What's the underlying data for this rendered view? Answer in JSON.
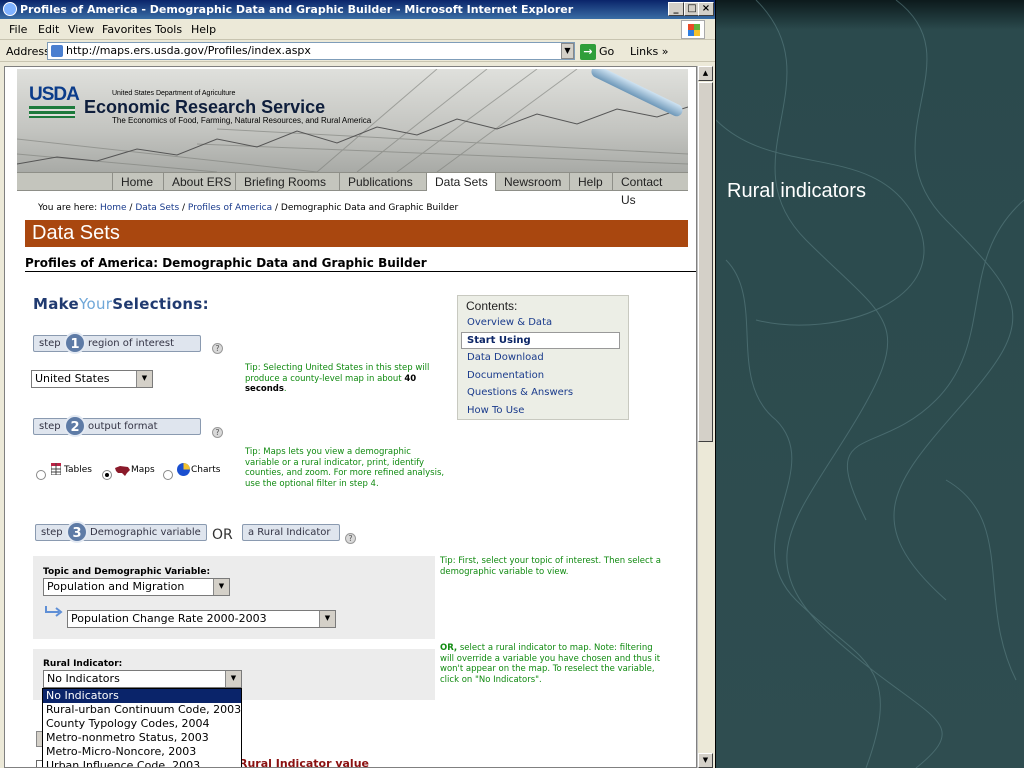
{
  "slide": {
    "caption": "Rural indicators"
  },
  "window": {
    "title": "Profiles of America - Demographic Data and Graphic Builder - Microsoft Internet Explorer",
    "buttons": [
      "_",
      "□",
      "×"
    ]
  },
  "menu": [
    "File",
    "Edit",
    "View",
    "Favorites",
    "Tools",
    "Help"
  ],
  "address_bar": {
    "label": "Address",
    "url": "http://maps.ers.usda.gov/Profiles/index.aspx",
    "go_label": "Go",
    "links_label": "Links »"
  },
  "header": {
    "logo": "USDA",
    "department": "United States Department of Agriculture",
    "agency": "Economic Research Service",
    "tagline": "The Economics of Food, Farming, Natural Resources, and Rural America"
  },
  "nav": [
    {
      "label": "Home",
      "active": false
    },
    {
      "label": "About ERS",
      "active": false
    },
    {
      "label": "Briefing Rooms",
      "active": false
    },
    {
      "label": "Publications",
      "active": false
    },
    {
      "label": "Data Sets",
      "active": true
    },
    {
      "label": "Newsroom",
      "active": false
    },
    {
      "label": "Help",
      "active": false
    },
    {
      "label": "Contact Us",
      "active": false
    }
  ],
  "breadcrumb": {
    "prefix": "You are here:",
    "links": [
      "Home",
      "Data Sets",
      "Profiles of America"
    ],
    "current": "Demographic Data and Graphic Builder"
  },
  "banner": "Data Sets",
  "page_title": "Profiles of America: Demographic Data and Graphic Builder",
  "selections_heading": {
    "make": "Make",
    "your": "Your",
    "selections": "Selections:"
  },
  "steps": {
    "step_word": "step",
    "step1": {
      "number": "1",
      "label": "region of interest"
    },
    "step2": {
      "number": "2",
      "label": "output format"
    },
    "step3": {
      "number": "3",
      "label": "Demographic variable",
      "or": "OR",
      "alt_label": "a Rural Indicator"
    }
  },
  "region": {
    "selected": "United States",
    "tip_pre": "Tip: Selecting United States in this step will produce a county-level map in about",
    "tip_bold": "40 seconds",
    "tip_post": "."
  },
  "output_format": {
    "options": [
      {
        "label": "Tables",
        "selected": false,
        "icon": "table-icon"
      },
      {
        "label": "Maps",
        "selected": true,
        "icon": "us-map-icon"
      },
      {
        "label": "Charts",
        "selected": false,
        "icon": "pie-chart-icon"
      }
    ],
    "tip": "Tip: Maps lets you view a demographic variable or a rural indicator, print, identify counties, and zoom. For more refined analysis, use the optional filter in step 4."
  },
  "contents": {
    "title": "Contents:",
    "items": [
      "Overview & Data",
      "Start Using",
      "Data Download",
      "Documentation",
      "Questions & Answers",
      "How To Use"
    ],
    "active": "Start Using"
  },
  "demographic": {
    "label": "Topic and Demographic Variable:",
    "topic": "Population and Migration",
    "variable": "Population Change Rate 2000-2003",
    "tip": "Tip: First, select your topic of interest. Then select a demographic variable to view."
  },
  "rural": {
    "label": "Rural Indicator:",
    "selected": "No Indicators",
    "options": [
      "No Indicators",
      "Rural-urban Continuum Code, 2003",
      "County Typology Codes, 2004",
      "Metro-nonmetro Status, 2003",
      "Metro-Micro-Noncore, 2003",
      "Urban Influence Code, 2003"
    ],
    "tip_bold": "OR,",
    "tip": "select a rural indicator to map. Note: filtering will override a variable you have chosen and thus it won't appear on the map. To reselect the variable, click on \"No Indicators\".",
    "value_heading": "Rural Indicator value"
  }
}
